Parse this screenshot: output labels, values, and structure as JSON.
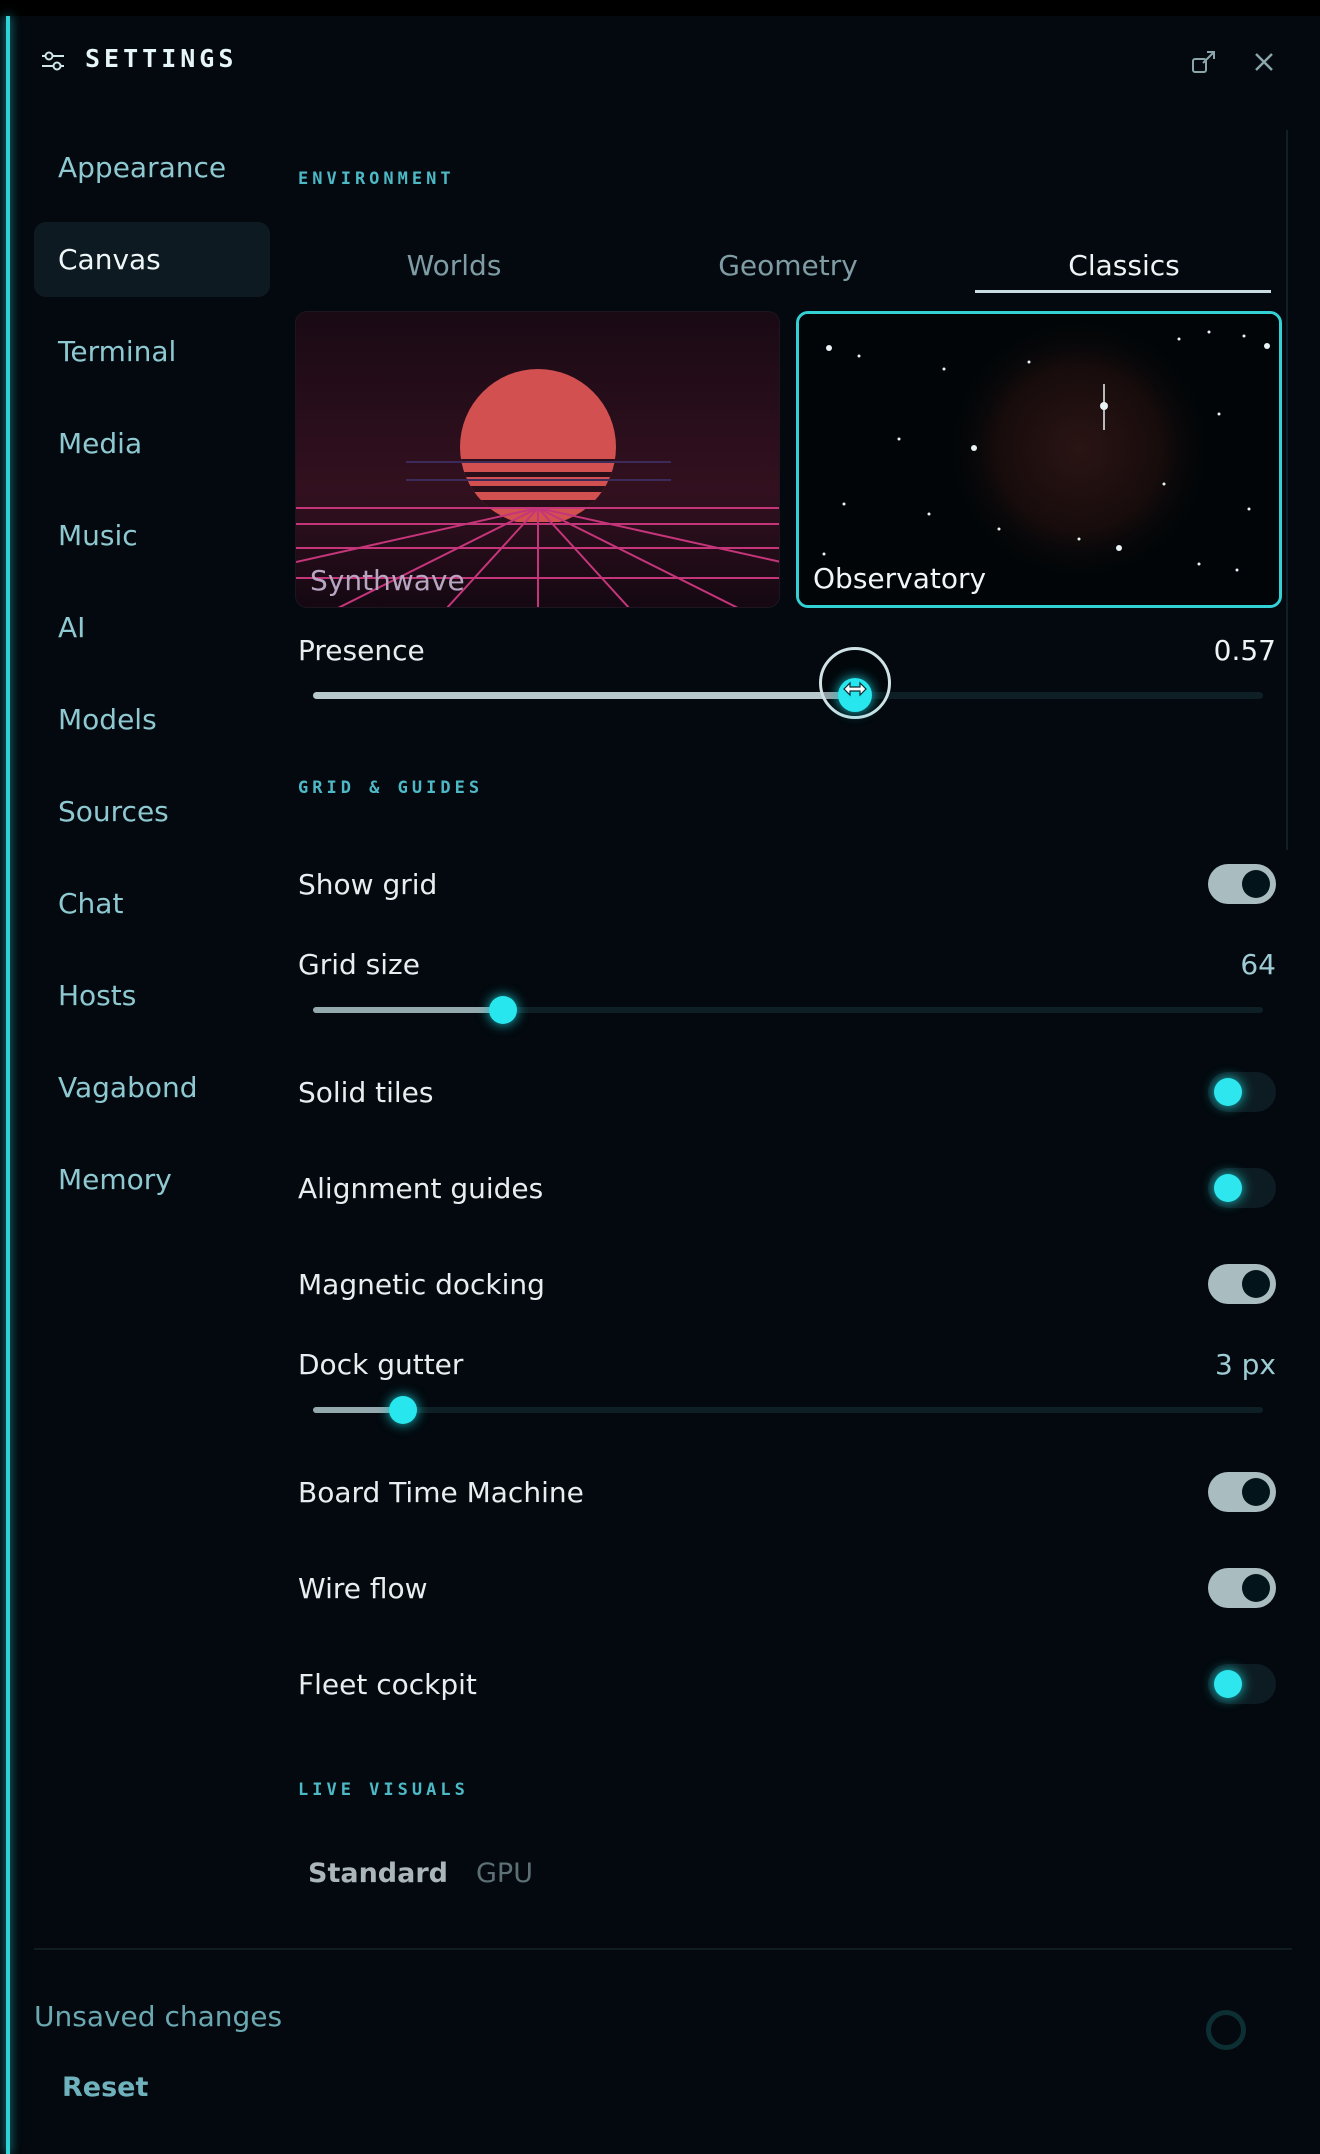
{
  "header": {
    "title": "SETTINGS"
  },
  "sidebar": {
    "items": [
      {
        "label": "Appearance"
      },
      {
        "label": "Canvas"
      },
      {
        "label": "Terminal"
      },
      {
        "label": "Media"
      },
      {
        "label": "Music"
      },
      {
        "label": "AI"
      },
      {
        "label": "Models"
      },
      {
        "label": "Sources"
      },
      {
        "label": "Chat"
      },
      {
        "label": "Hosts"
      },
      {
        "label": "Vagabond"
      },
      {
        "label": "Memory"
      }
    ],
    "active": "Canvas"
  },
  "environment": {
    "section": "ENVIRONMENT",
    "tabs": [
      {
        "label": "Worlds"
      },
      {
        "label": "Geometry"
      },
      {
        "label": "Classics"
      }
    ],
    "active_tab": "Classics",
    "cards": [
      {
        "label": "Synthwave"
      },
      {
        "label": "Observatory"
      }
    ],
    "selected_card": "Observatory",
    "presence": {
      "label": "Presence",
      "value": "0.57",
      "fraction": 0.57
    }
  },
  "grid": {
    "section": "GRID & GUIDES",
    "show_grid": {
      "label": "Show grid",
      "on": true
    },
    "grid_size": {
      "label": "Grid size",
      "value": "64",
      "fraction": 0.2
    },
    "solid_tiles": {
      "label": "Solid tiles",
      "on": false
    },
    "alignment_guides": {
      "label": "Alignment guides",
      "on": false
    },
    "magnetic_docking": {
      "label": "Magnetic docking",
      "on": true
    },
    "dock_gutter": {
      "label": "Dock gutter",
      "value": "3 px",
      "fraction": 0.095
    },
    "board_time_machine": {
      "label": "Board Time Machine",
      "on": true
    },
    "wire_flow": {
      "label": "Wire flow",
      "on": true
    },
    "fleet_cockpit": {
      "label": "Fleet cockpit",
      "on": false
    }
  },
  "live_visuals": {
    "section": "LIVE VISUALS",
    "options": [
      {
        "label": "Standard"
      },
      {
        "label": "GPU"
      }
    ],
    "selected": "Standard"
  },
  "footer": {
    "status": "Unsaved changes",
    "reset_label": "Reset"
  },
  "colors": {
    "accent": "#2ee7ee",
    "background": "#03090e",
    "sidebar_text": "#8ec9d2"
  }
}
